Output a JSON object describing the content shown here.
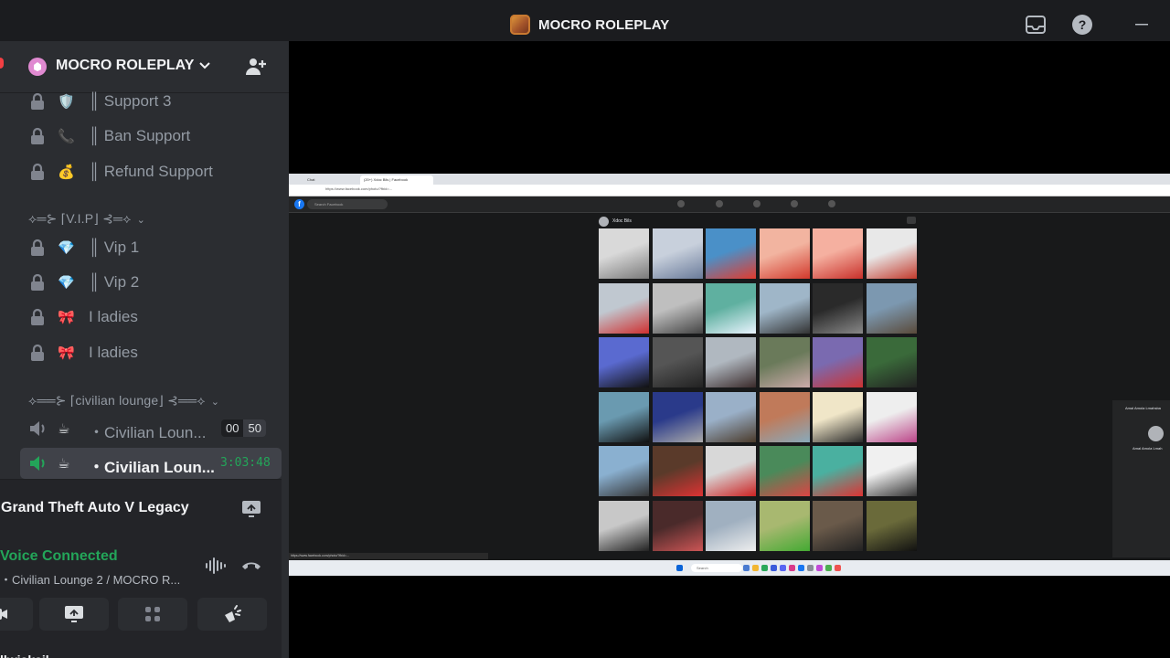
{
  "window": {
    "title": "MOCRO ROLEPLAY"
  },
  "server": {
    "name": "MOCRO ROLEPLAY"
  },
  "channels": [
    {
      "emoji": "🛡️",
      "label": "║ Support 3",
      "locked": true
    },
    {
      "emoji": "📞",
      "label": "║ Ban Support",
      "locked": true
    },
    {
      "emoji": "💰",
      "label": "║ Refund Support",
      "locked": true
    }
  ],
  "categories": {
    "vip": "⟡═⊱ ⌈V.I.P⌋ ⊰═⟡",
    "civilian": "⟡══⊱ ⌈civilian lounge⌋ ⊰══⟡"
  },
  "vip_channels": [
    {
      "emoji": "💎",
      "label": "║ Vip 1",
      "locked": true
    },
    {
      "emoji": "💎",
      "label": "║ Vip 2",
      "locked": true
    },
    {
      "emoji": "🎀",
      "label": "I ladies",
      "locked": true
    },
    {
      "emoji": "🎀",
      "label": "I ladies",
      "locked": true
    }
  ],
  "voice_channels": [
    {
      "emoji": "☕",
      "label": "・Civilian Loun...",
      "count_a": "00",
      "count_b": "50",
      "active": false
    },
    {
      "emoji": "☕",
      "label": "・Civilian Loun...",
      "timer": "3:03:48",
      "active": true
    }
  ],
  "activity": {
    "game": "Grand Theft Auto V Legacy"
  },
  "voice": {
    "status": "Voice Connected",
    "channel": "・Civilian Lounge 2 / MOCRO R...",
    "username": "llwiskail"
  },
  "stream": {
    "tab1": "Chat",
    "tab2": "(20+) Xdoc Bils | Facebook",
    "url": "https://www.facebook.com/photo/?fbid=...",
    "search_placeholder": "Search Facebook",
    "album_owner": "Xdoc Bils",
    "chat_name": "Amal Amola Lmahsba",
    "chat_name2": "Amal Amola Lmah",
    "status_url": "https://www.facebook.com/photo/?fbid=...",
    "taskbar_search": "Search"
  }
}
